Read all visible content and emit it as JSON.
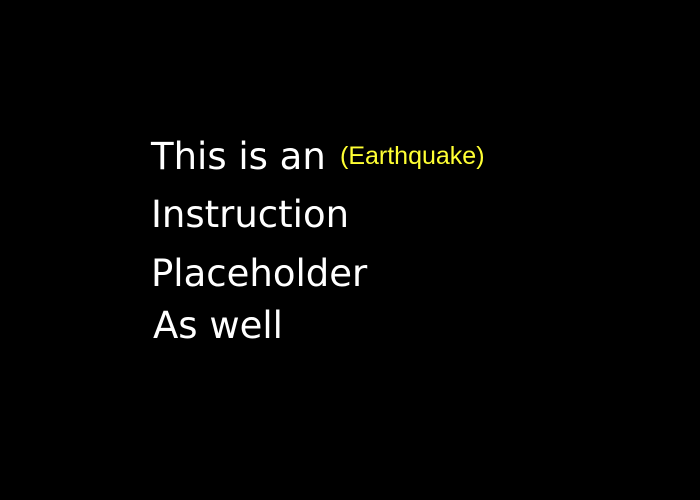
{
  "instruction": {
    "line1": "This is an",
    "tag": "(Earthquake)",
    "line2": "Instruction",
    "line3": "Placeholder",
    "line4": "As well"
  },
  "colors": {
    "background": "#000000",
    "text": "#ffffff",
    "tag": "#ffff33"
  }
}
